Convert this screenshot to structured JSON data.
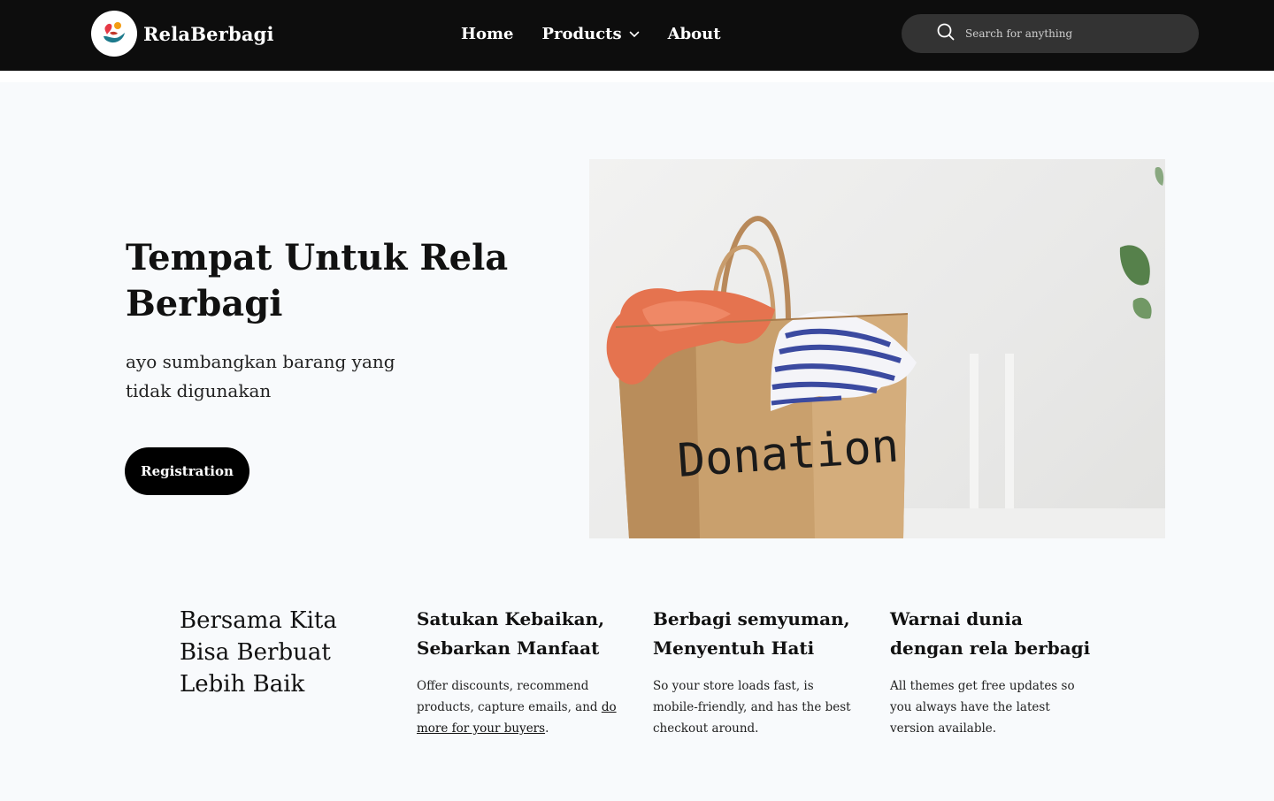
{
  "header": {
    "brand_name": "RelaBerbagi",
    "nav": [
      {
        "label": "Home"
      },
      {
        "label": "Products"
      },
      {
        "label": "About"
      }
    ],
    "search_placeholder": "Search for anything"
  },
  "hero": {
    "title": "Tempat Untuk Rela Berbagi",
    "subtitle": "ayo sumbangkan barang yang tidak digunakan",
    "button_label": "Registration",
    "image_text": "Donation"
  },
  "features": {
    "lead": "Bersama Kita Bisa Berbuat Lebih Baik",
    "items": [
      {
        "title": "Satukan Kebaikan, Sebarkan Manfaat",
        "text_before": "Offer discounts, recommend products, capture emails, and ",
        "link": "do more for your buyers",
        "text_after": "."
      },
      {
        "title": "Berbagi semyuman, Menyentuh Hati",
        "text_before": "So your store loads fast, is mobile-friendly, and has the best checkout around.",
        "link": "",
        "text_after": ""
      },
      {
        "title": "Warnai dunia dengan rela berbagi",
        "text_before": "All themes get free updates so you always have the latest version available.",
        "link": "",
        "text_after": ""
      }
    ]
  },
  "colors": {
    "header_bg": "#0d0d0d",
    "page_bg": "#f8fafc",
    "search_bg": "#333333",
    "button_bg": "#000000"
  }
}
